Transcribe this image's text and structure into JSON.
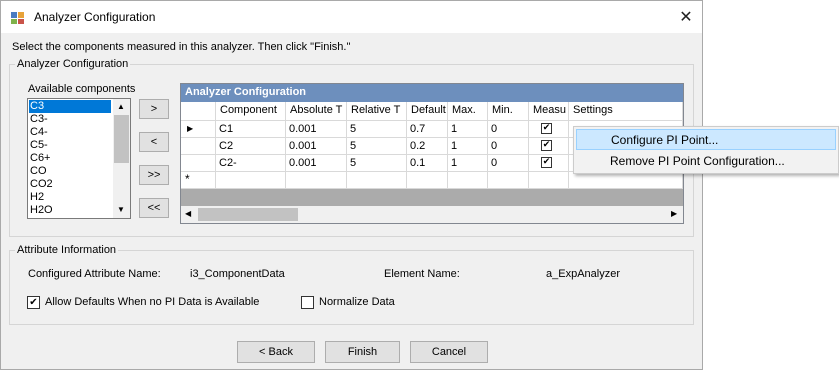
{
  "window": {
    "title": "Analyzer Configuration"
  },
  "instructions": "Select the components measured in this analyzer. Then click \"Finish.\"",
  "analyzer_group": {
    "label": "Analyzer Configuration",
    "available_label": "Available components",
    "components": [
      "C3",
      "C3-",
      "C4-",
      "C5-",
      "C6+",
      "CO",
      "CO2",
      "H2",
      "H2O"
    ],
    "selected_index": 0,
    "buttons": {
      "add": ">",
      "remove": "<",
      "add_all": ">>",
      "remove_all": "<<"
    }
  },
  "grid": {
    "caption": "Analyzer Configuration",
    "columns": [
      "Component",
      "Absolute T",
      "Relative T",
      "Default",
      "Max.",
      "Min.",
      "Measu",
      "Settings"
    ],
    "rows": [
      {
        "component": "C1",
        "absolute": "0.001",
        "relative": "5",
        "default": "0.7",
        "max": "1",
        "min": "0",
        "measured": true
      },
      {
        "component": "C2",
        "absolute": "0.001",
        "relative": "5",
        "default": "0.2",
        "max": "1",
        "min": "0",
        "measured": true
      },
      {
        "component": "C2-",
        "absolute": "0.001",
        "relative": "5",
        "default": "0.1",
        "max": "1",
        "min": "0",
        "measured": true
      }
    ],
    "current_row_marker": "▶",
    "new_row_marker": "*"
  },
  "context_menu": {
    "items": [
      "Configure PI Point...",
      "Remove PI Point Configuration..."
    ],
    "highlighted_index": 0
  },
  "attribute_group": {
    "label": "Attribute Information",
    "configured_label": "Configured Attribute Name:",
    "configured_value": "i3_ComponentData",
    "element_label": "Element Name:",
    "element_value": "a_ExpAnalyzer",
    "allow_defaults_label": "Allow Defaults When no PI Data is Available",
    "allow_defaults_checked": true,
    "normalize_label": "Normalize Data",
    "normalize_checked": false
  },
  "footer": {
    "back": "< Back",
    "finish": "Finish",
    "cancel": "Cancel"
  },
  "colors": {
    "grid_caption": "#6d8fbd",
    "selection": "#0078d7",
    "menu_highlight": "#cce8ff"
  }
}
